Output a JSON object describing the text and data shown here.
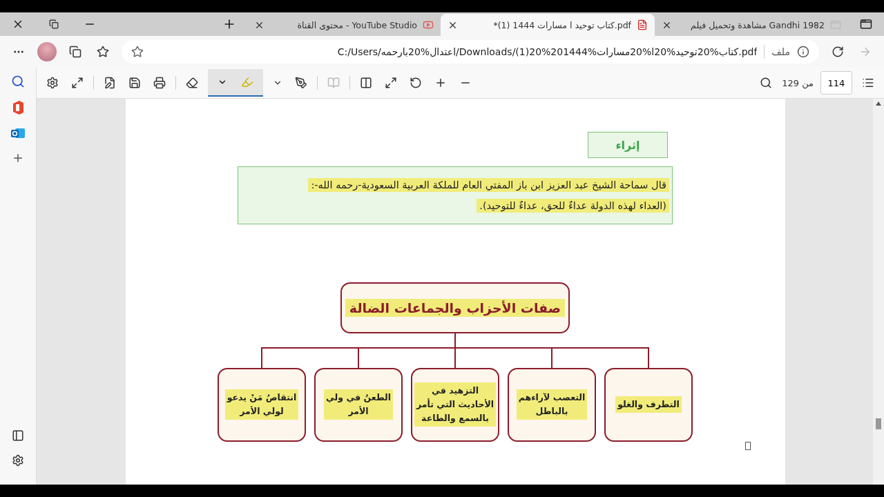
{
  "tabs": [
    {
      "title": "مشاهدة وتحميل فيلم Gandhi 1982",
      "kind": "site",
      "selected": false
    },
    {
      "title": "*كتاب توحيد ا مسارات 1444 (1).pdf",
      "kind": "pdf",
      "selected": true
    },
    {
      "title": "محتوى القناة - YouTube Studio",
      "kind": "video",
      "selected": false
    }
  ],
  "address_bar": {
    "label": "ملف",
    "url": "C:/Users/اعتدال%20بارحمه/Downloads/كتاب%20توحيد%20ا%20مسارات%201444%20(1).pdf"
  },
  "pdf_toolbar": {
    "highlighter_selected": true,
    "page": "114",
    "page_total": "من 129"
  },
  "document": {
    "badge": "إثراء",
    "quote_lines": [
      "قال سماحة الشيخ عبد العزيز ابن باز المفتي العام للملكة العربية السعودية-رحمه الله-:",
      "(العداء لهذه الدولة عداءٌ للحق، عداءٌ للتوحيد)."
    ],
    "diagram": {
      "title": "صفات الأحزاب والجماعات الضالة",
      "nodes": [
        "التطرف والغلو",
        "التعصب لآراءهم\nبالباطل",
        "التزهيد في\nالأحاديث التي تأمر\nبالسمع والطاعة",
        "الطعنُ في ولي\nالأمر",
        "انتقاصُ مَنْ يدعو\nلولي الأمر"
      ]
    }
  }
}
